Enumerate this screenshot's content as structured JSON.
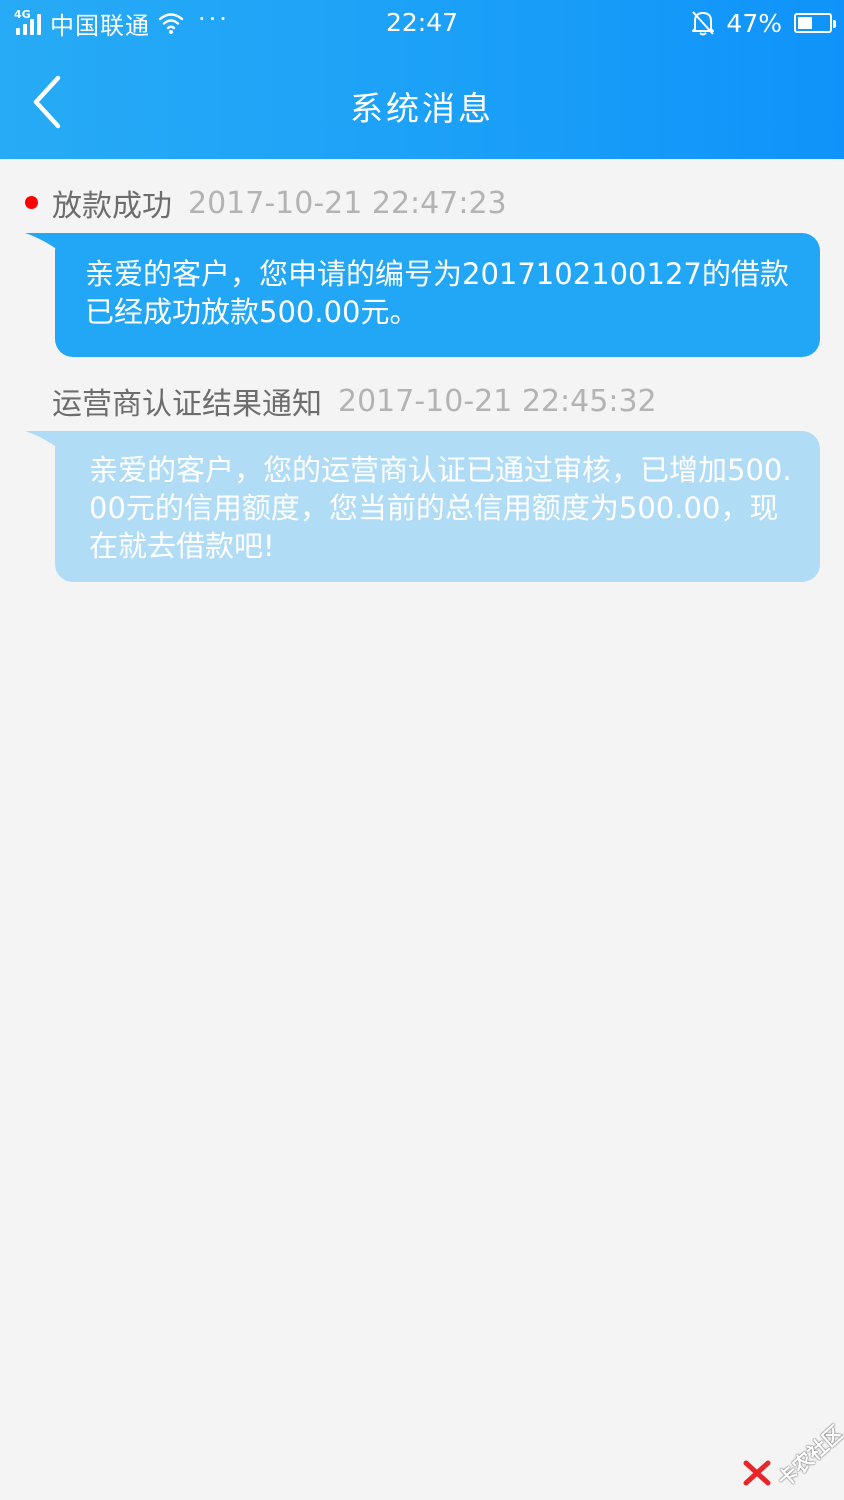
{
  "status_bar": {
    "network": "4G",
    "carrier": "中国联通",
    "more": "···",
    "time": "22:47",
    "battery": "47%",
    "battery_level": 0.47
  },
  "header": {
    "title": "系统消息",
    "back_icon": "chevron-left-icon"
  },
  "messages": [
    {
      "title": "放款成功",
      "time": "2017-10-21 22:47:23",
      "unread": true,
      "body": "亲爱的客户，您申请的编号为2017102100127的借款已经成功放款500.00元。"
    },
    {
      "title": "运营商认证结果通知",
      "time": "2017-10-21 22:45:32",
      "unread": false,
      "body": "亲爱的客户，您的运营商认证已通过审核，已增加500.00元的信用额度，您当前的总信用额度为500.00，现在就去借款吧!"
    }
  ],
  "watermark": {
    "text": "卡农社区"
  },
  "colors": {
    "header_blue": "#1ba0f8",
    "bubble_active": "#22a6f6",
    "bubble_read": "#b0dcf6",
    "unread_dot": "#ff0000",
    "background": "#f4f4f4"
  }
}
